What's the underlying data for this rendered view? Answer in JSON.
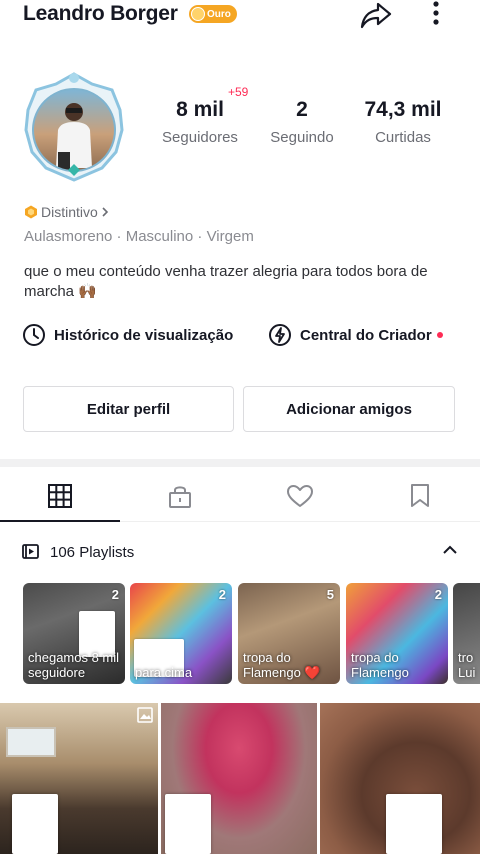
{
  "header": {
    "username": "Leandro Borger",
    "badge_label": "Ouro"
  },
  "stats": {
    "followers_value": "8 mil",
    "followers_label": "Seguidores",
    "new_followers": "+59",
    "following_value": "2",
    "following_label": "Seguindo",
    "likes_value": "74,3 mil",
    "likes_label": "Curtidas"
  },
  "profile": {
    "distinct_label": "Distintivo",
    "meta": "Aulasmoreno · Masculino · Virgem",
    "bio": "que o meu conteúdo venha trazer alegria para todos bora de marcha 🙌🏾"
  },
  "links": {
    "history_label": "Histórico de visualização",
    "creator_label": "Central do Criador"
  },
  "buttons": {
    "edit_label": "Editar perfil",
    "add_friends_label": "Adicionar amigos"
  },
  "tabs": [
    {
      "icon": "grid-icon",
      "active": true
    },
    {
      "icon": "lock-icon",
      "active": false
    },
    {
      "icon": "heart-icon",
      "active": false
    },
    {
      "icon": "bookmark-icon",
      "active": false
    }
  ],
  "playlists": {
    "header": "106 Playlists",
    "items": [
      {
        "count": "2",
        "title": "chegamos 8 mil seguidore"
      },
      {
        "count": "2",
        "title": "para cima"
      },
      {
        "count": "5",
        "title": "tropa do Flamengo ❤️"
      },
      {
        "count": "2",
        "title": "tropa do Flamengo"
      },
      {
        "count": "",
        "title": "tro Lui"
      }
    ]
  },
  "colors": {
    "accent_red": "#fe2c55",
    "badge_gold": "#f5a623",
    "text_primary": "#161823",
    "text_secondary": "#6b6d74"
  }
}
